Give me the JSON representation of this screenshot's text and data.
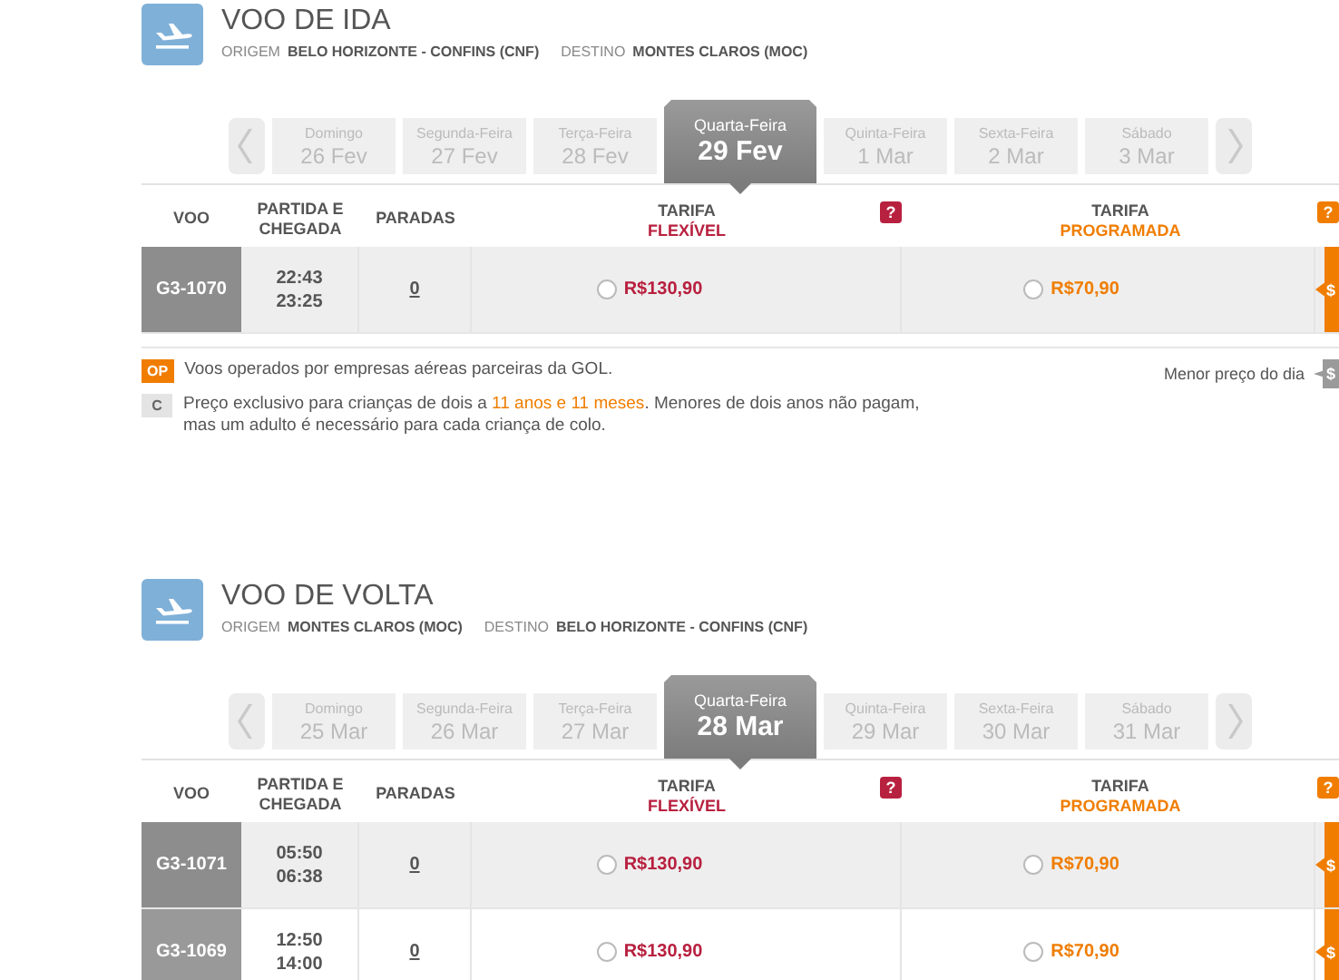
{
  "sections": [
    {
      "title": "VOO DE IDA",
      "origin_label": "ORIGEM",
      "origin": "BELO HORIZONTE - CONFINS (CNF)",
      "destination_label": "DESTINO",
      "destination": "MONTES CLAROS (MOC)",
      "dates": [
        {
          "weekday": "Domingo",
          "date": "26 Fev",
          "selected": false
        },
        {
          "weekday": "Segunda-Feira",
          "date": "27 Fev",
          "selected": false
        },
        {
          "weekday": "Terça-Feira",
          "date": "28 Fev",
          "selected": false
        },
        {
          "weekday": "Quarta-Feira",
          "date": "29 Fev",
          "selected": true
        },
        {
          "weekday": "Quinta-Feira",
          "date": "1 Mar",
          "selected": false
        },
        {
          "weekday": "Sexta-Feira",
          "date": "2 Mar",
          "selected": false
        },
        {
          "weekday": "Sábado",
          "date": "3 Mar",
          "selected": false
        }
      ],
      "columns": {
        "flight": "VOO",
        "times": "PARTIDA E CHEGADA",
        "stops": "PARADAS",
        "fares": [
          {
            "label": "TARIFA",
            "name": "FLEXÍVEL",
            "help": "?",
            "color": "#b8203f"
          },
          {
            "label": "TARIFA",
            "name": "PROGRAMADA",
            "help": "?",
            "color": "#f07d00"
          }
        ]
      },
      "flights": [
        {
          "number": "G3-1070",
          "departure": "22:43",
          "arrival": "23:25",
          "stops": "0",
          "highlighted": true,
          "prices": [
            {
              "amount": "R$130,90",
              "selected": false
            },
            {
              "amount": "R$70,90",
              "selected": false
            }
          ],
          "lowest_marker": "$"
        }
      ],
      "legend": {
        "items": [
          {
            "badge": "OP",
            "kind": "operated",
            "parts": [
              "Voos operados por empresas aéreas parceiras da GOL."
            ]
          },
          {
            "badge": "C",
            "kind": "child",
            "parts": [
              "Preço exclusivo para crianças de dois a ",
              "11 anos e 11 meses",
              ". Menores de dois anos não pagam, mas um adulto é necessário para cada criança de colo."
            ]
          }
        ],
        "lowest_note": "Menor preço do dia",
        "lowest_marker": "$"
      }
    },
    {
      "title": "VOO DE VOLTA",
      "origin_label": "ORIGEM",
      "origin": "MONTES CLAROS (MOC)",
      "destination_label": "DESTINO",
      "destination": "BELO HORIZONTE - CONFINS (CNF)",
      "dates": [
        {
          "weekday": "Domingo",
          "date": "25 Mar",
          "selected": false
        },
        {
          "weekday": "Segunda-Feira",
          "date": "26 Mar",
          "selected": false
        },
        {
          "weekday": "Terça-Feira",
          "date": "27 Mar",
          "selected": false
        },
        {
          "weekday": "Quarta-Feira",
          "date": "28 Mar",
          "selected": true
        },
        {
          "weekday": "Quinta-Feira",
          "date": "29 Mar",
          "selected": false
        },
        {
          "weekday": "Sexta-Feira",
          "date": "30 Mar",
          "selected": false
        },
        {
          "weekday": "Sábado",
          "date": "31 Mar",
          "selected": false
        }
      ],
      "columns": {
        "flight": "VOO",
        "times": "PARTIDA E CHEGADA",
        "stops": "PARADAS",
        "fares": [
          {
            "label": "TARIFA",
            "name": "FLEXÍVEL",
            "help": "?",
            "color": "#b8203f"
          },
          {
            "label": "TARIFA",
            "name": "PROGRAMADA",
            "help": "?",
            "color": "#f07d00"
          }
        ]
      },
      "flights": [
        {
          "number": "G3-1071",
          "departure": "05:50",
          "arrival": "06:38",
          "stops": "0",
          "highlighted": true,
          "prices": [
            {
              "amount": "R$130,90",
              "selected": false
            },
            {
              "amount": "R$70,90",
              "selected": false
            }
          ],
          "lowest_marker": "$"
        },
        {
          "number": "G3-1069",
          "departure": "12:50",
          "arrival": "14:00",
          "stops": "0",
          "highlighted": false,
          "prices": [
            {
              "amount": "R$130,90",
              "selected": false
            },
            {
              "amount": "R$70,90",
              "selected": false
            }
          ],
          "lowest_marker": "$"
        }
      ]
    }
  ]
}
